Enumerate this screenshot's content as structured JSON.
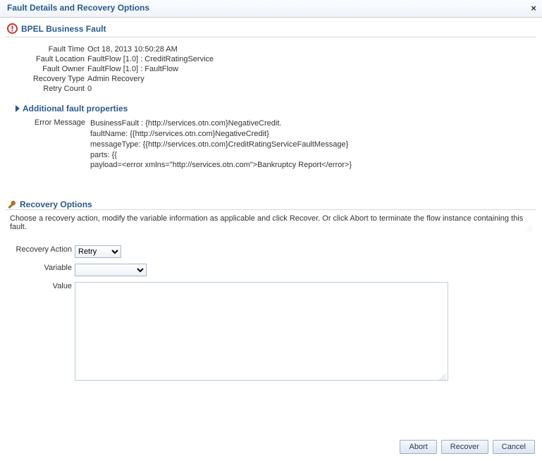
{
  "dialog": {
    "title": "Fault Details and Recovery Options"
  },
  "fault_header": {
    "title": "BPEL Business Fault"
  },
  "details": {
    "fault_time_label": "Fault Time",
    "fault_time_value": "Oct 18, 2013 10:50:28 AM",
    "fault_location_label": "Fault Location",
    "fault_location_value": "FaultFlow [1.0] : CreditRatingService",
    "fault_owner_label": "Fault Owner",
    "fault_owner_value": "FaultFlow [1.0] : FaultFlow",
    "recovery_type_label": "Recovery Type",
    "recovery_type_value": "Admin Recovery",
    "retry_count_label": "Retry Count",
    "retry_count_value": "0"
  },
  "additional_props": {
    "label": "Additional fault properties"
  },
  "error": {
    "label": "Error Message",
    "body": "BusinessFault : {http://services.otn.com}NegativeCredit.\nfaultName: {{http://services.otn.com}NegativeCredit}\nmessageType: {{http://services.otn.com}CreditRatingServiceFaultMessage}\nparts: {{\npayload=<error xmlns=\"http://services.otn.com\">Bankruptcy Report</error>}"
  },
  "recovery": {
    "header": "Recovery Options",
    "description": "Choose a recovery action, modify the variable information as applicable and click Recover. Or click Abort to terminate the flow instance containing this fault.",
    "action_label": "Recovery Action",
    "action_value": "Retry",
    "variable_label": "Variable",
    "variable_value": "",
    "value_label": "Value",
    "value_text": ""
  },
  "buttons": {
    "abort": "Abort",
    "recover": "Recover",
    "cancel": "Cancel"
  }
}
